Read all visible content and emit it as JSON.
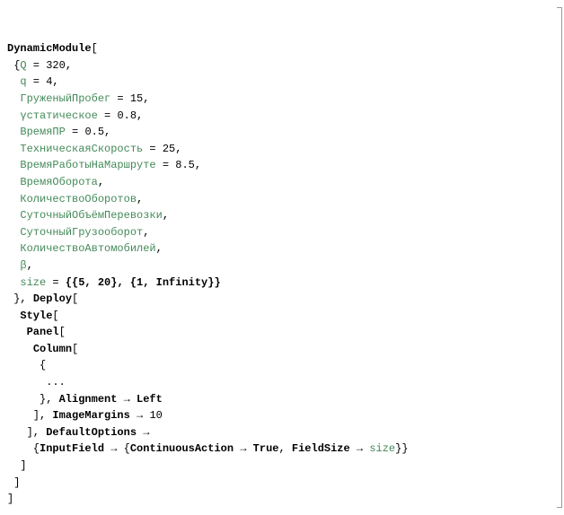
{
  "code": {
    "l01_dynmod": "DynamicModule",
    "l01_lbr": "[",
    "l02_lb": " {",
    "l02_Q": "Q",
    "l02_eq": " = ",
    "l02_val": "320",
    "l02_c": ",",
    "l03_sp": "  ",
    "l03_q": "q",
    "l03_eq": " = ",
    "l03_val": "4",
    "l03_c": ",",
    "l04_sp": "  ",
    "l04_s": "ГруженыйПробег",
    "l04_eq": " = ",
    "l04_val": "15",
    "l04_c": ",",
    "l05_sp": "  ",
    "l05_s": "γстатическое",
    "l05_eq": " = ",
    "l05_val": "0.8",
    "l05_c": ",",
    "l06_sp": "  ",
    "l06_s": "ВремяПР",
    "l06_eq": " = ",
    "l06_val": "0.5",
    "l06_c": ",",
    "l07_sp": "  ",
    "l07_s": "ТехническаяСкорость",
    "l07_eq": " = ",
    "l07_val": "25",
    "l07_c": ",",
    "l08_sp": "  ",
    "l08_s": "ВремяРаботыНаМаршруте",
    "l08_eq": " = ",
    "l08_val": "8.5",
    "l08_c": ",",
    "l09_sp": "  ",
    "l09_s": "ВремяОборота",
    "l09_c": ",",
    "l10_sp": "  ",
    "l10_s": "КоличествоОборотов",
    "l10_c": ",",
    "l11_sp": "  ",
    "l11_s": "СуточныйОбъёмПеревозки",
    "l11_c": ",",
    "l12_sp": "  ",
    "l12_s": "СуточныйГрузооборот",
    "l12_c": ",",
    "l13_sp": "  ",
    "l13_s": "КоличествоАвтомобилей",
    "l13_c": ",",
    "l14_sp": "  ",
    "l14_s": "β",
    "l14_c": ",",
    "l15_sp": "  ",
    "l15_s": "size",
    "l15_eq": " = ",
    "l15_val": "{{5, 20}, {1, Infinity}}",
    "l16_rb": " }, ",
    "l16_deploy": "Deploy",
    "l16_lbr": "[",
    "l17_sp": "  ",
    "l17_style": "Style",
    "l17_lbr": "[",
    "l18_sp": "   ",
    "l18_panel": "Panel",
    "l18_lbr": "[",
    "l19_sp": "    ",
    "l19_col": "Column",
    "l19_lbr": "[",
    "l20_sp": "     {",
    "l21_sp": "      ...",
    "l22_sp": "     }, ",
    "l22_align": "Alignment",
    "l22_arr": " → ",
    "l22_left": "Left",
    "l23_sp": "    ], ",
    "l23_img": "ImageMargins",
    "l23_arr": " → ",
    "l23_val": "10",
    "l24_sp": "   ], ",
    "l24_def": "DefaultOptions",
    "l24_arr": " →",
    "l25_sp": "    {",
    "l25_inp": "InputField",
    "l25_arr1": " → ",
    "l25_lb": "{",
    "l25_ca": "ContinuousAction",
    "l25_arr2": " → ",
    "l25_true": "True",
    "l25_c": ", ",
    "l25_fs": "FieldSize",
    "l25_arr3": " → ",
    "l25_size": "size",
    "l25_rb": "}}",
    "l26_sp": "  ]",
    "l27_sp": " ]",
    "l28_sp": "]"
  }
}
